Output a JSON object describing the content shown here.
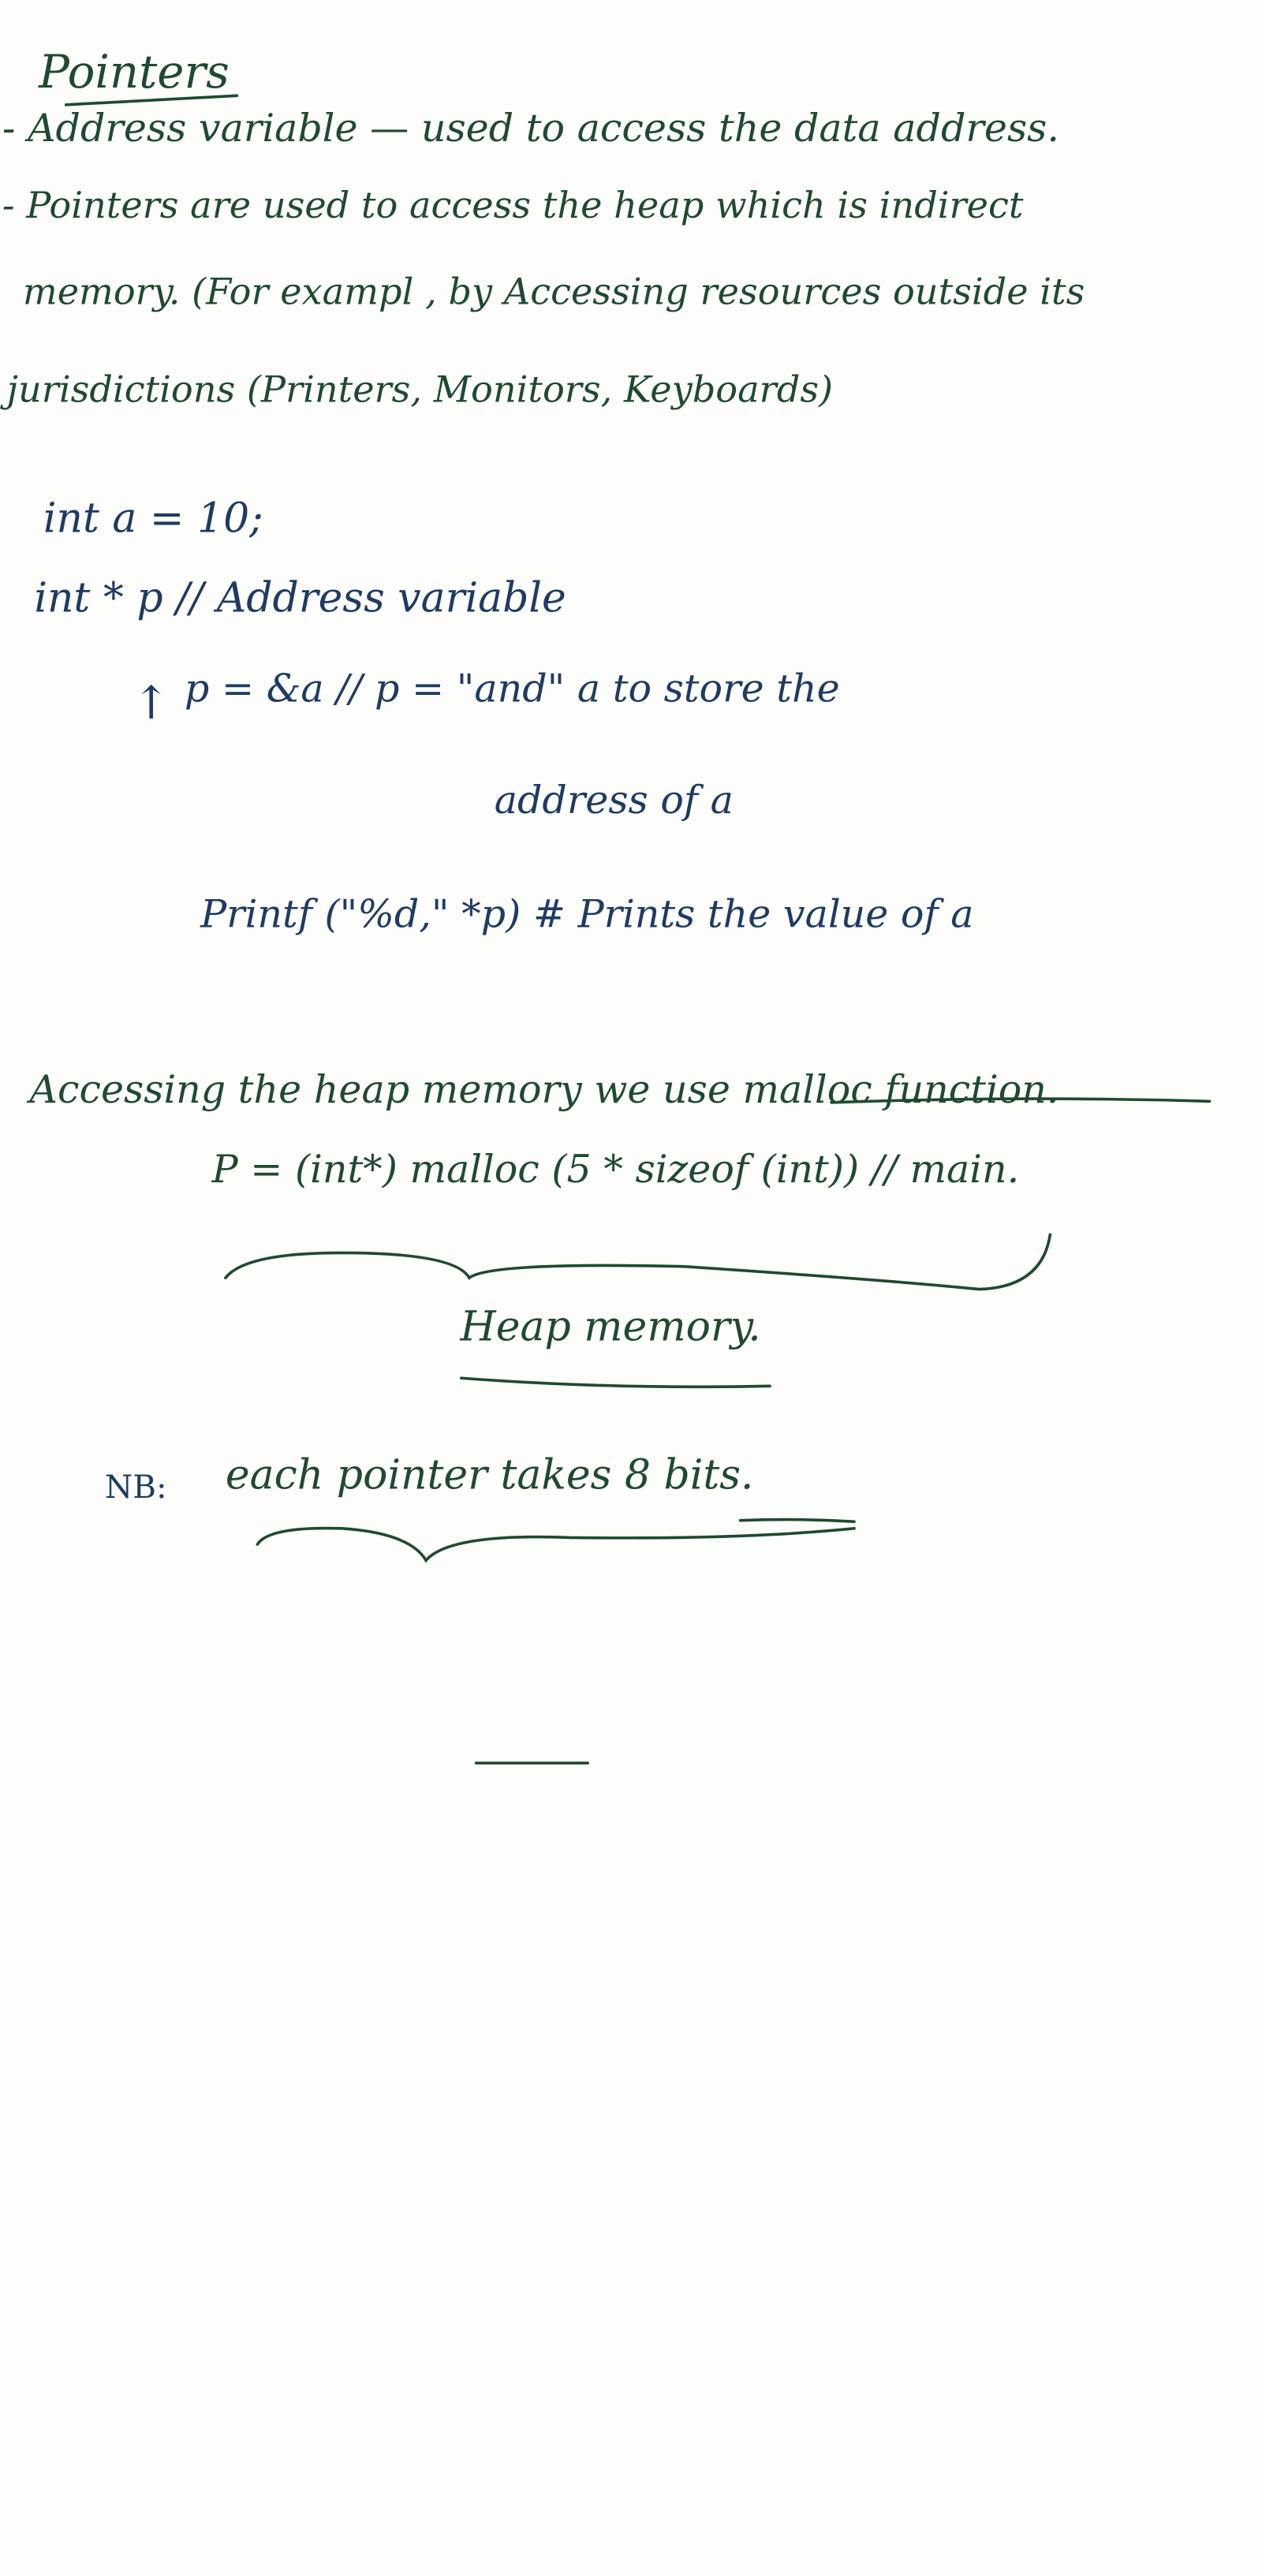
{
  "title": "Pointers",
  "intro": {
    "bullet1": "- Address variable — used to access the data address.",
    "bullet2_line1": "- Pointers are used to access the heap which is indirect",
    "bullet2_line2": "memory. (For exampl , by Accessing resources outside its",
    "bullet2_line3": "jurisdictions (Printers, Monitors, Keyboards)"
  },
  "code": {
    "line1": "int a = 10;",
    "line2": "int * p // Address variable",
    "arrow": "↑",
    "line3": "p = &a // p = \"and\" a to store the",
    "line3_cont": "address of a",
    "line4": "Printf (\"%d,\" *p) # Prints the value of a"
  },
  "heap": {
    "sentence": "Accessing the heap memory we use malloc function.",
    "code": "P = (int*) malloc (5 * sizeof (int)) // main.",
    "label": "Heap memory."
  },
  "note": {
    "prefix": "NB:",
    "text": "each pointer takes 8 bits."
  }
}
